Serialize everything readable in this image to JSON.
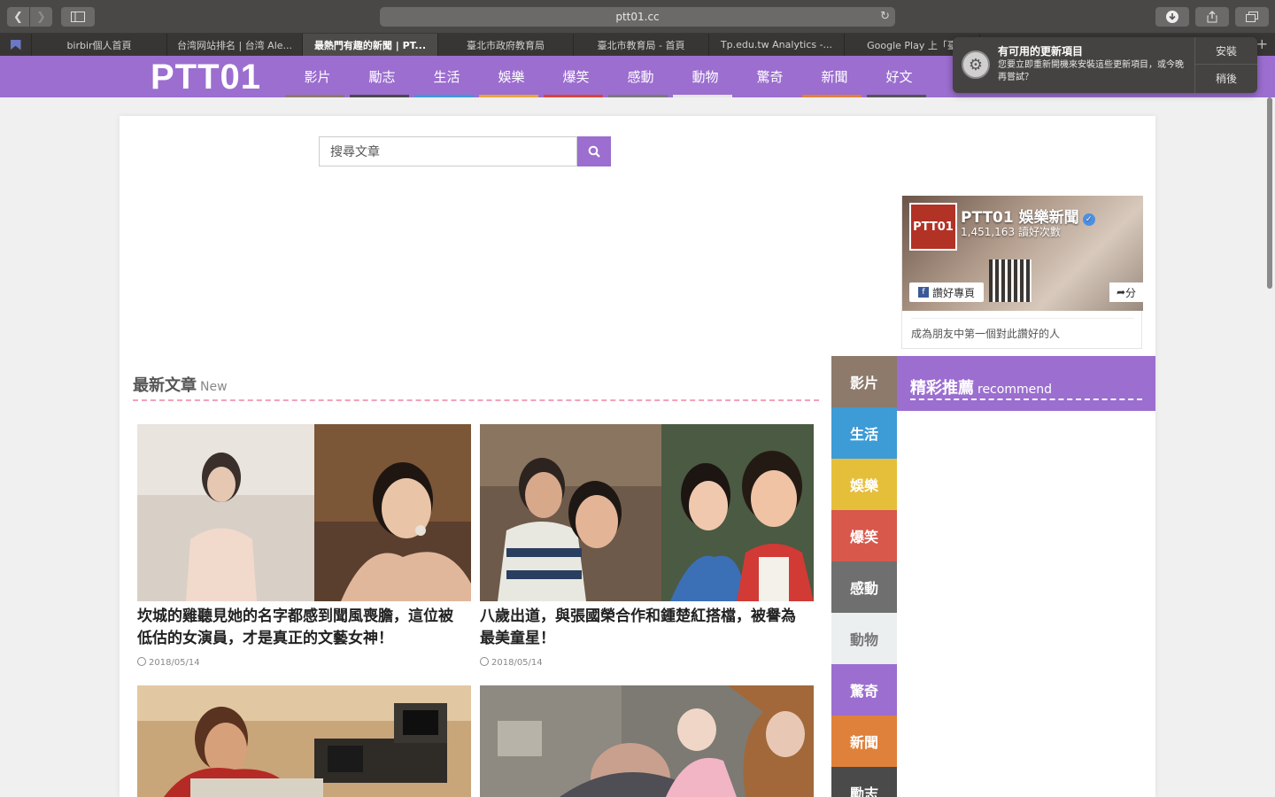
{
  "browser": {
    "url": "ptt01.cc",
    "tabs": [
      {
        "label": "birbir個人首頁",
        "active": false
      },
      {
        "label": "台湾网站排名 | 台湾 Ale...",
        "active": false
      },
      {
        "label": "最熱門有趣的新聞 | PT...",
        "active": true
      },
      {
        "label": "臺北市政府教育局",
        "active": false
      },
      {
        "label": "臺北市教育局 - 首頁",
        "active": false
      },
      {
        "label": "Tp.edu.tw Analytics -...",
        "active": false
      },
      {
        "label": "Google Play 上「臺",
        "active": false
      }
    ]
  },
  "notification": {
    "title": "有可用的更新項目",
    "body": "您要立即重新開機來安裝這些更新項目，或今晚再嘗試？",
    "install": "安裝",
    "later": "稍後"
  },
  "site": {
    "logo": "PTT01",
    "menu": [
      {
        "label": "影片",
        "color": "#8d7a6b"
      },
      {
        "label": "勵志",
        "color": "#4a4a4a"
      },
      {
        "label": "生活",
        "color": "#3d9bd6"
      },
      {
        "label": "娛樂",
        "color": "#e8a838"
      },
      {
        "label": "爆笑",
        "color": "#d8453b"
      },
      {
        "label": "感動",
        "color": "#7a7a7a"
      },
      {
        "label": "動物",
        "color": "#e6e6e6"
      },
      {
        "label": "驚奇",
        "color": "#9b6ecf"
      },
      {
        "label": "新聞",
        "color": "#e0813b"
      },
      {
        "label": "好文",
        "color": "#555555"
      }
    ],
    "search_placeholder": "搜尋文章"
  },
  "latest": {
    "title": "最新文章",
    "subtitle": "New",
    "articles": [
      {
        "title": "坎城的雞聽見她的名字都感到聞風喪膽，這位被低估的女演員，才是真正的文藝女神！",
        "date": "2018/05/14"
      },
      {
        "title": "八歲出道，與張國榮合作和鍾楚紅搭檔，被譽為最美童星！",
        "date": "2018/05/14"
      }
    ]
  },
  "categories": [
    {
      "label": "影片",
      "color": "#8d7a6b"
    },
    {
      "label": "生活",
      "color": "#3d9bd6"
    },
    {
      "label": "娛樂",
      "color": "#e6bf3a"
    },
    {
      "label": "爆笑",
      "color": "#d8584b"
    },
    {
      "label": "感動",
      "color": "#6f6f6f"
    },
    {
      "label": "動物",
      "color": "#eceff0"
    },
    {
      "label": "驚奇",
      "color": "#9b6ecf"
    },
    {
      "label": "新聞",
      "color": "#e0813b"
    },
    {
      "label": "勵志",
      "color": "#4a4a4a"
    }
  ],
  "recommend": {
    "title": "精彩推薦",
    "subtitle": "recommend"
  },
  "fb_widget": {
    "avatar_text": "PTT01",
    "page_name": "PTT01 娛樂新聞",
    "likes": "1,451,163 讀好次數",
    "like_button": "讚好專頁",
    "share": "分",
    "friends_text": "成為朋友中第一個對此讚好的人"
  }
}
